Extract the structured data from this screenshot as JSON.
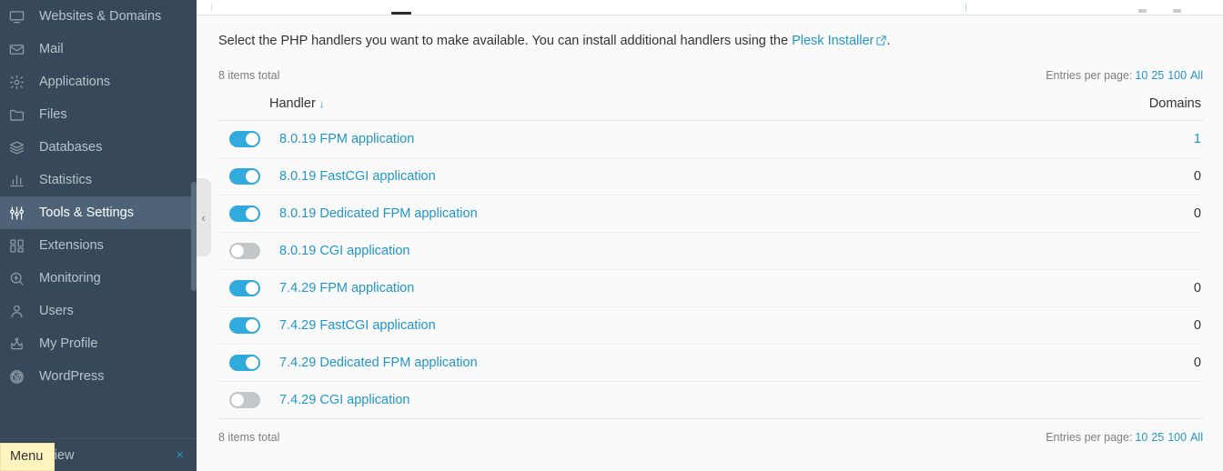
{
  "sidebar": {
    "items": [
      {
        "label": "Websites & Domains",
        "icon": "monitor-icon",
        "active": false
      },
      {
        "label": "Mail",
        "icon": "envelope-icon",
        "active": false
      },
      {
        "label": "Applications",
        "icon": "gear-icon",
        "active": false
      },
      {
        "label": "Files",
        "icon": "folder-icon",
        "active": false
      },
      {
        "label": "Databases",
        "icon": "database-stack-icon",
        "active": false
      },
      {
        "label": "Statistics",
        "icon": "bar-chart-icon",
        "active": false
      },
      {
        "label": "Tools & Settings",
        "icon": "sliders-icon",
        "active": true
      },
      {
        "label": "Extensions",
        "icon": "blocks-icon",
        "active": false
      },
      {
        "label": "Monitoring",
        "icon": "magnifier-icon",
        "active": false
      },
      {
        "label": "Users",
        "icon": "person-icon",
        "active": false
      },
      {
        "label": "My Profile",
        "icon": "crown-icon",
        "active": false
      },
      {
        "label": "WordPress",
        "icon": "wordpress-icon",
        "active": false
      }
    ],
    "change_view": {
      "label": "ange View",
      "close": "×"
    },
    "tooltip": "Menu",
    "collapse_chevron": "‹"
  },
  "main": {
    "intro": {
      "before": "Select the PHP handlers you want to make available. You can install additional handlers using the ",
      "link": "Plesk Installer",
      "after": "."
    },
    "items_total": "8 items total",
    "entries_per_page": {
      "label": "Entries per page:",
      "options": [
        "10",
        "25",
        "100",
        "All"
      ]
    },
    "table": {
      "columns": {
        "handler": "Handler",
        "domains": "Domains"
      },
      "sort_arrow": "↓",
      "rows": [
        {
          "enabled": true,
          "handler": "8.0.19 FPM application",
          "domains": "1",
          "domains_is_link": true
        },
        {
          "enabled": true,
          "handler": "8.0.19 FastCGI application",
          "domains": "0",
          "domains_is_link": false
        },
        {
          "enabled": true,
          "handler": "8.0.19 Dedicated FPM application",
          "domains": "0",
          "domains_is_link": false
        },
        {
          "enabled": false,
          "handler": "8.0.19 CGI application",
          "domains": "",
          "domains_is_link": false
        },
        {
          "enabled": true,
          "handler": "7.4.29 FPM application",
          "domains": "0",
          "domains_is_link": false
        },
        {
          "enabled": true,
          "handler": "7.4.29 FastCGI application",
          "domains": "0",
          "domains_is_link": false
        },
        {
          "enabled": true,
          "handler": "7.4.29 Dedicated FPM application",
          "domains": "0",
          "domains_is_link": false
        },
        {
          "enabled": false,
          "handler": "7.4.29 CGI application",
          "domains": "",
          "domains_is_link": false
        }
      ]
    },
    "footer": {
      "items_total": "8 items total",
      "entries_per_page_label": "Entries per page:",
      "entries_per_page_options": [
        "10",
        "25",
        "100",
        "All"
      ]
    }
  },
  "colors": {
    "sidebar_bg": "#37485a",
    "sidebar_active_bg": "#4e6377",
    "link": "#2196c9",
    "toggle_on": "#31aadd",
    "toggle_off": "#c3c7ca",
    "tooltip_bg": "#fdf3bf"
  }
}
